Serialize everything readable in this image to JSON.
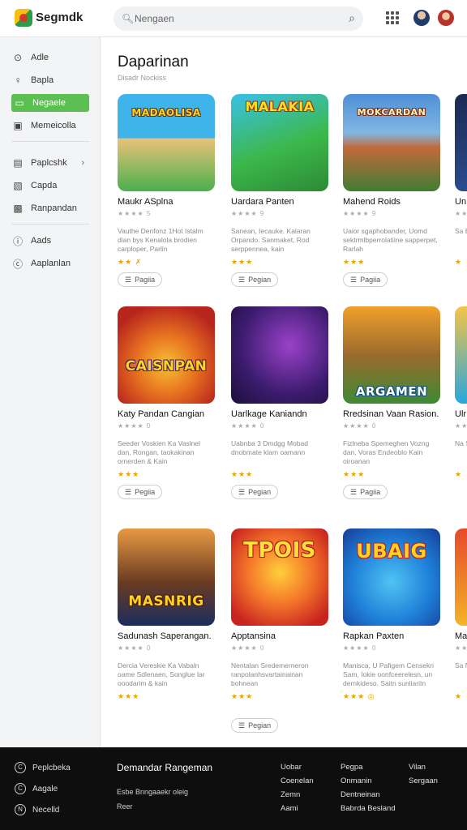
{
  "header": {
    "brand": "Segmdk",
    "search_placeholder": "Nengaen"
  },
  "sidebar": {
    "group1": [
      {
        "icon": "info-circle-icon",
        "glyph": "⊙",
        "label": "Adle"
      },
      {
        "icon": "pin-icon",
        "glyph": "♀",
        "label": "Bapla"
      },
      {
        "icon": "rectangle-icon",
        "glyph": "▭",
        "label": "Negaele",
        "active": true
      },
      {
        "icon": "bookmark-icon",
        "glyph": "▣",
        "label": "Memeicolla"
      }
    ],
    "group2": [
      {
        "icon": "folder-icon",
        "glyph": "▤",
        "label": "Paplcshk",
        "chevron": "›"
      },
      {
        "icon": "doc-icon",
        "glyph": "▧",
        "label": "Capda"
      },
      {
        "icon": "file-icon",
        "glyph": "▩",
        "label": "Ranpandan"
      }
    ],
    "group3": [
      {
        "icon": "info-icon",
        "glyph": "ⓘ",
        "label": "Aads"
      },
      {
        "icon": "settings-icon",
        "glyph": "ⓒ",
        "label": "Aaplanlan"
      }
    ]
  },
  "main": {
    "title": "Daparinan",
    "subtitle": "Disadr Nockiss",
    "cards": [
      {
        "name": "Maukr ASplna",
        "rating": "★★★★ 5",
        "desc": "Vauthe Denfonz 1Hot Istalm dian bys Kenalola brodien carploper, Parlin",
        "stars": "★★ ✗",
        "pill": "Pagiia",
        "art": "MADAOLISA"
      },
      {
        "name": "Uardara Panten",
        "rating": "★★★★ 9",
        "desc": "Sanean, Iecauke. Kalaran Orpando. Sanmaket, Rod serppennea, kain",
        "stars": "★★★",
        "pill": "Pegian",
        "art": "MALAKIA"
      },
      {
        "name": "Mahend Roids",
        "rating": "★★★★ 9",
        "desc": "Uaior sgaphobander, Uomd sektrmlbperrolatiine sapperpet, Rarlah",
        "stars": "★★★",
        "pill": "Pagiia",
        "art": "MOKCARDAN"
      },
      {
        "name": "Un",
        "rating": "★★",
        "desc": "Sa Be Ba",
        "stars": "★",
        "pill": "",
        "art": ""
      },
      {
        "name": "Katy Pandan Cangian",
        "rating": "★★★★ 0",
        "desc": "Seeder Voskien Ka Vaslnel dan, Rongan, taokakinan ornerden & Kain",
        "stars": "★★★",
        "pill": "Pegiia",
        "art": "CAISNPAN"
      },
      {
        "name": "Uarlkage Kaniandn",
        "rating": "★★★★ 0",
        "desc": "Uabnba 3 Dmdgg Mobad dnobmate klam oamann",
        "stars": "★★★",
        "pill": "Pegian",
        "art": ""
      },
      {
        "name": "Rredsinan Vaan Rasion.",
        "rating": "★★★★ 0",
        "desc": "Fizlneba Spemeghen Vozng dan, Voras Endeoblo Kain oiroanan",
        "stars": "★★★",
        "pill": "Pagiia",
        "art": "ARGAMEN"
      },
      {
        "name": "Ulr Des",
        "rating": "★★",
        "desc": "Na Sa Fu",
        "stars": "★",
        "pill": "",
        "art": ""
      },
      {
        "name": "Sadunash Saperangan.",
        "rating": "★★★★ 0",
        "desc": "Dercia Vereskie Ka Vabaln oame Sdlenaen, Songlue Iar ooodarim & kain",
        "stars": "★★★",
        "pill": "",
        "art": "MASNRIG"
      },
      {
        "name": "Apptansina",
        "rating": "★★★★ 0",
        "desc": "Nentalan Sredemerneron ranpolanhsvartainainan bohnean",
        "stars": "★★★",
        "pill": "Pegian",
        "art": "TPOIS"
      },
      {
        "name": "Rapkan Paxten",
        "rating": "★★★★ 0",
        "desc": "Manisca, U Pafigem Censekri Sam, Iokie oonfceerelesn, un dernkideso. Saitn sunliaritn",
        "stars": "★★★ ◎",
        "pill": "",
        "art": "UBAIG"
      },
      {
        "name": "Ma",
        "rating": "★★",
        "desc": "Sa Na Dn",
        "stars": "★",
        "pill": "",
        "art": ""
      }
    ]
  },
  "footer": {
    "items": [
      {
        "glyph": "C",
        "label": "Peplcbeka"
      },
      {
        "glyph": "C",
        "label": "Aagale"
      },
      {
        "glyph": "N",
        "label": "Necelld"
      }
    ],
    "title": "Demandar Rangeman",
    "sub1": "Esbe Bnngaaekr oleig",
    "sub2": "Reer",
    "col1": [
      "Uobar",
      "Coenelan",
      "Zemn",
      "Aami"
    ],
    "col2": [
      "Pegpa",
      "Onmanin",
      "Dentneinan",
      "Babrda Besland"
    ],
    "col3": [
      "Vilan",
      "Sergaan"
    ]
  }
}
